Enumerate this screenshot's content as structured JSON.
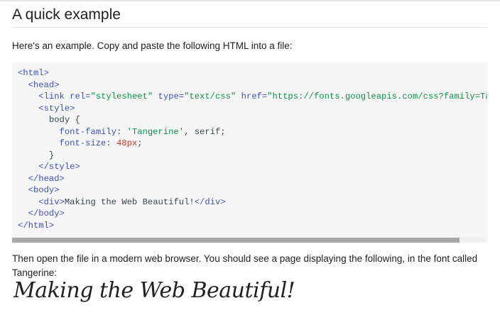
{
  "section": {
    "title": "A quick example"
  },
  "intro": "Here's an example. Copy and paste the following HTML into a file:",
  "code": {
    "lines": [
      "<html>",
      "  <head>",
      "    <link rel=\"stylesheet\" type=\"text/css\" href=\"https://fonts.googleapis.com/css?family=Tangerine\">",
      "    <style>",
      "      body {",
      "        font-family: 'Tangerine', serif;",
      "        font-size: 48px;",
      "      }",
      "    </style>",
      "  </head>",
      "  <body>",
      "    <div>Making the Web Beautiful!</div>",
      "  </body>",
      "</html>"
    ]
  },
  "outro": "Then open the file in a modern web browser. You should see a page displaying the following, in the font called Tangerine:",
  "sample": {
    "text": "Making the Web Beautiful!"
  },
  "colors": {
    "tag": "#3f51b5",
    "string": "#0d904f",
    "number": "#c53929",
    "code_bg": "#f5f5f5",
    "scroll_thumb": "#a8a8a8"
  }
}
